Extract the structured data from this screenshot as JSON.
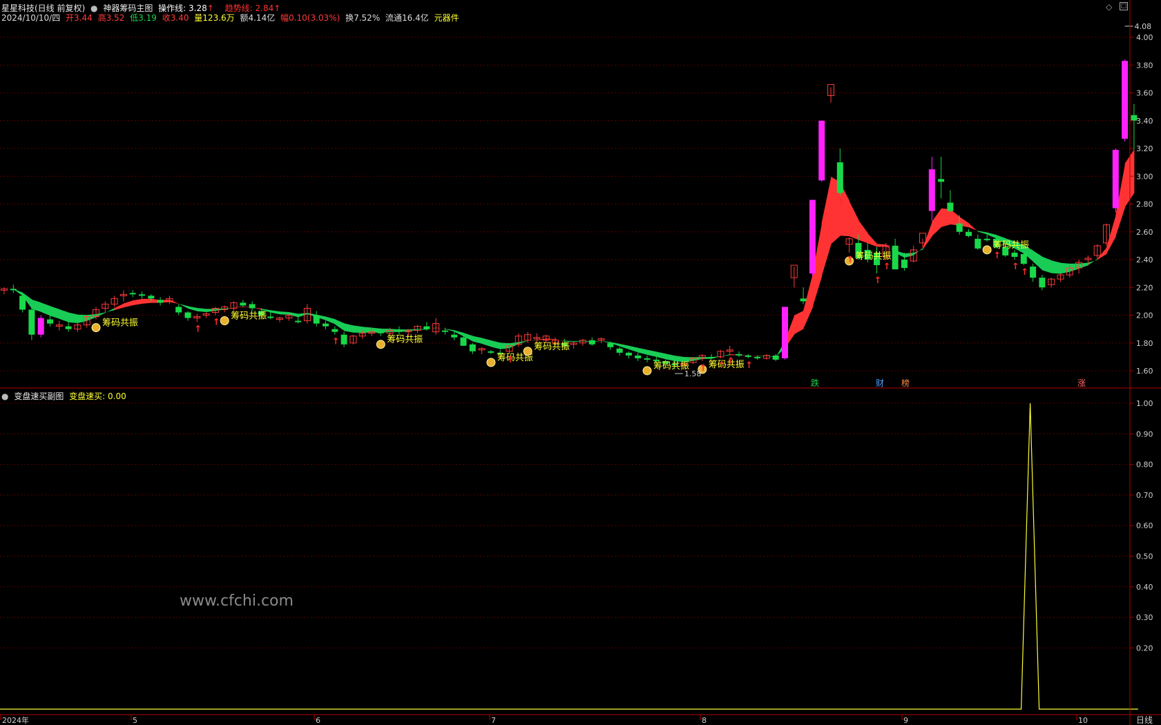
{
  "main_header": {
    "stock_name": "星星科技(日线 前复权)",
    "indicator_name": "神器筹码主图",
    "op_line_label": "操作线: 3.28",
    "trend_line_label": "趋势线: 2.84"
  },
  "bar_info": {
    "date": "2024/10/10/四",
    "open": "开3.44",
    "high": "高3.52",
    "low": "低3.19",
    "close": "收3.40",
    "volume": "量123.6万",
    "amount": "额4.14亿",
    "change": "幅0.10(3.03%)",
    "turnover": "换7.52%",
    "float": "流通16.4亿",
    "sector": "元器件"
  },
  "sub_header": {
    "indicator_name": "变盘速买副图",
    "value_label": "变盘速买: 0.00"
  },
  "main_annotations": {
    "max_label": "4.08",
    "min_label": "1.58",
    "signal_label": "筹码共振",
    "bottom_tags": [
      "跌",
      "财",
      "榜",
      "涨"
    ]
  },
  "time_axis": {
    "labels": [
      "2024年",
      "5",
      "6",
      "7",
      "8",
      "9",
      "10"
    ],
    "period_label": "日线"
  },
  "watermark": "www.cfchi.com",
  "colors": {
    "up": "#ff3b3b",
    "down": "#19d94a",
    "magenta": "#ff22ff",
    "yellow": "#ffff33",
    "axis_red": "#b00000",
    "band_red": "#ff3333",
    "band_green": "#19cc55"
  },
  "chart_data": [
    {
      "type": "candlestick",
      "title": "",
      "ylim": [
        1.5,
        4.1
      ],
      "yticks": [
        "4.00",
        "3.80",
        "3.60",
        "3.40",
        "3.20",
        "3.00",
        "2.80",
        "2.60",
        "2.40",
        "2.20",
        "2.00",
        "1.80",
        "1.60"
      ],
      "grid": true,
      "x_ticks": [
        "2024年",
        "5",
        "6",
        "7",
        "8",
        "9",
        "10"
      ],
      "ohlc": [
        [
          2.18,
          2.2,
          2.15,
          2.19
        ],
        [
          2.19,
          2.22,
          2.16,
          2.18
        ],
        [
          2.14,
          2.16,
          2.02,
          2.04
        ],
        [
          2.04,
          2.08,
          1.82,
          1.86
        ],
        [
          1.86,
          2.0,
          1.84,
          1.98
        ],
        [
          1.97,
          2.02,
          1.92,
          1.94
        ],
        [
          1.92,
          1.96,
          1.89,
          1.93
        ],
        [
          1.92,
          1.95,
          1.88,
          1.9
        ],
        [
          1.9,
          1.95,
          1.88,
          1.93
        ],
        [
          1.93,
          2.0,
          1.91,
          1.99
        ],
        [
          1.99,
          2.06,
          1.97,
          2.04
        ],
        [
          2.05,
          2.1,
          2.02,
          2.08
        ],
        [
          2.08,
          2.14,
          2.06,
          2.12
        ],
        [
          2.14,
          2.18,
          2.1,
          2.15
        ],
        [
          2.16,
          2.18,
          2.13,
          2.15
        ],
        [
          2.15,
          2.17,
          2.12,
          2.14
        ],
        [
          2.14,
          2.15,
          2.1,
          2.12
        ],
        [
          2.11,
          2.13,
          2.07,
          2.09
        ],
        [
          2.1,
          2.14,
          2.08,
          2.12
        ],
        [
          2.06,
          2.08,
          2.0,
          2.02
        ],
        [
          2.02,
          2.03,
          1.96,
          1.98
        ],
        [
          1.98,
          2.01,
          1.95,
          1.99
        ],
        [
          2.0,
          2.02,
          1.98,
          2.01
        ],
        [
          2.02,
          2.06,
          2.0,
          2.05
        ],
        [
          2.04,
          2.07,
          2.02,
          2.06
        ],
        [
          2.05,
          2.1,
          2.03,
          2.09
        ],
        [
          2.09,
          2.11,
          2.06,
          2.07
        ],
        [
          2.08,
          2.1,
          2.03,
          2.05
        ],
        [
          2.03,
          2.05,
          1.98,
          2.0
        ],
        [
          1.99,
          2.02,
          1.97,
          1.98
        ],
        [
          1.97,
          1.99,
          1.95,
          1.98
        ],
        [
          1.98,
          2.01,
          1.96,
          2.0
        ],
        [
          1.96,
          2.0,
          1.94,
          1.95
        ],
        [
          1.96,
          2.08,
          1.94,
          2.05
        ],
        [
          2.0,
          2.03,
          1.92,
          1.94
        ],
        [
          1.94,
          1.96,
          1.9,
          1.92
        ],
        [
          1.9,
          1.92,
          1.86,
          1.88
        ],
        [
          1.86,
          1.88,
          1.77,
          1.79
        ],
        [
          1.8,
          1.86,
          1.79,
          1.85
        ],
        [
          1.85,
          1.89,
          1.83,
          1.87
        ],
        [
          1.87,
          1.91,
          1.85,
          1.88
        ],
        [
          1.88,
          1.9,
          1.85,
          1.87
        ],
        [
          1.87,
          1.91,
          1.85,
          1.89
        ],
        [
          1.89,
          1.92,
          1.86,
          1.88
        ],
        [
          1.88,
          1.9,
          1.85,
          1.89
        ],
        [
          1.89,
          1.93,
          1.87,
          1.92
        ],
        [
          1.92,
          1.95,
          1.89,
          1.9
        ],
        [
          1.88,
          1.98,
          1.86,
          1.94
        ],
        [
          1.89,
          1.91,
          1.86,
          1.88
        ],
        [
          1.86,
          1.88,
          1.82,
          1.84
        ],
        [
          1.84,
          1.86,
          1.78,
          1.78
        ],
        [
          1.79,
          1.8,
          1.72,
          1.74
        ],
        [
          1.75,
          1.77,
          1.72,
          1.76
        ],
        [
          1.74,
          1.75,
          1.72,
          1.73
        ],
        [
          1.73,
          1.75,
          1.71,
          1.72
        ],
        [
          1.74,
          1.79,
          1.73,
          1.78
        ],
        [
          1.79,
          1.87,
          1.77,
          1.85
        ],
        [
          1.82,
          1.88,
          1.8,
          1.86
        ],
        [
          1.83,
          1.87,
          1.8,
          1.84
        ],
        [
          1.82,
          1.86,
          1.8,
          1.85
        ],
        [
          1.8,
          1.84,
          1.78,
          1.82
        ],
        [
          1.8,
          1.83,
          1.76,
          1.78
        ],
        [
          1.79,
          1.81,
          1.76,
          1.8
        ],
        [
          1.8,
          1.83,
          1.78,
          1.82
        ],
        [
          1.82,
          1.84,
          1.78,
          1.79
        ],
        [
          1.82,
          1.84,
          1.8,
          1.83
        ],
        [
          1.8,
          1.81,
          1.75,
          1.77
        ],
        [
          1.76,
          1.77,
          1.71,
          1.73
        ],
        [
          1.73,
          1.74,
          1.69,
          1.71
        ],
        [
          1.71,
          1.73,
          1.67,
          1.69
        ],
        [
          1.69,
          1.71,
          1.66,
          1.68
        ],
        [
          1.68,
          1.7,
          1.66,
          1.67
        ],
        [
          1.67,
          1.68,
          1.64,
          1.65
        ],
        [
          1.65,
          1.67,
          1.61,
          1.64
        ],
        [
          1.64,
          1.66,
          1.62,
          1.65
        ],
        [
          1.66,
          1.7,
          1.65,
          1.69
        ],
        [
          1.69,
          1.72,
          1.67,
          1.71
        ],
        [
          1.7,
          1.72,
          1.68,
          1.69
        ],
        [
          1.7,
          1.75,
          1.69,
          1.74
        ],
        [
          1.74,
          1.78,
          1.72,
          1.75
        ],
        [
          1.72,
          1.74,
          1.7,
          1.71
        ],
        [
          1.71,
          1.72,
          1.69,
          1.7
        ],
        [
          1.7,
          1.71,
          1.68,
          1.69
        ],
        [
          1.69,
          1.72,
          1.68,
          1.71
        ],
        [
          1.71,
          1.72,
          1.67,
          1.68
        ],
        [
          1.69,
          2.06,
          1.68,
          2.06
        ],
        [
          2.27,
          2.35,
          2.2,
          2.36
        ],
        [
          2.12,
          2.2,
          2.08,
          2.1
        ],
        [
          2.3,
          2.55,
          2.28,
          2.83
        ],
        [
          2.97,
          3.4,
          2.96,
          3.4
        ],
        [
          3.58,
          3.64,
          3.53,
          3.66
        ],
        [
          3.1,
          3.2,
          2.86,
          2.88
        ],
        [
          2.51,
          2.56,
          2.45,
          2.55
        ],
        [
          2.52,
          2.58,
          2.4,
          2.41
        ],
        [
          2.47,
          2.52,
          2.38,
          2.4
        ],
        [
          2.45,
          2.49,
          2.3,
          2.36
        ],
        [
          2.42,
          2.52,
          2.4,
          2.5
        ],
        [
          2.5,
          2.55,
          2.34,
          2.33
        ],
        [
          2.4,
          2.45,
          2.32,
          2.34
        ],
        [
          2.39,
          2.5,
          2.38,
          2.47
        ],
        [
          2.52,
          2.55,
          2.49,
          2.59
        ],
        [
          2.75,
          3.14,
          2.68,
          3.05
        ],
        [
          2.98,
          3.14,
          2.84,
          2.96
        ],
        [
          2.81,
          2.9,
          2.74,
          2.75
        ],
        [
          2.66,
          2.72,
          2.58,
          2.6
        ],
        [
          2.6,
          2.62,
          2.56,
          2.57
        ],
        [
          2.55,
          2.58,
          2.47,
          2.48
        ],
        [
          2.55,
          2.58,
          2.53,
          2.54
        ],
        [
          2.55,
          2.56,
          2.48,
          2.49
        ],
        [
          2.49,
          2.53,
          2.42,
          2.43
        ],
        [
          2.45,
          2.47,
          2.4,
          2.42
        ],
        [
          2.44,
          2.46,
          2.36,
          2.37
        ],
        [
          2.35,
          2.37,
          2.24,
          2.27
        ],
        [
          2.27,
          2.29,
          2.18,
          2.2
        ],
        [
          2.22,
          2.27,
          2.2,
          2.26
        ],
        [
          2.26,
          2.3,
          2.24,
          2.29
        ],
        [
          2.29,
          2.36,
          2.27,
          2.34
        ],
        [
          2.34,
          2.4,
          2.3,
          2.38
        ],
        [
          2.4,
          2.43,
          2.36,
          2.41
        ],
        [
          2.43,
          2.51,
          2.41,
          2.5
        ],
        [
          2.52,
          2.66,
          2.5,
          2.65
        ],
        [
          2.77,
          3.2,
          2.74,
          3.19
        ],
        [
          3.27,
          3.84,
          3.25,
          3.83
        ],
        [
          3.44,
          3.52,
          3.19,
          3.4
        ]
      ],
      "lines": [
        {
          "name": "操作线",
          "value": 3.28
        },
        {
          "name": "趋势线",
          "value": 2.84
        }
      ]
    },
    {
      "type": "line",
      "title": "",
      "ylim": [
        0,
        1.0
      ],
      "yticks": [
        "1.00",
        "0.90",
        "0.80",
        "0.70",
        "0.60",
        "0.50",
        "0.40",
        "0.30",
        "0.20"
      ],
      "series": [
        {
          "name": "变盘速买",
          "spike_index": 112,
          "spike_value": 1.0,
          "baseline": 0.0
        }
      ]
    }
  ]
}
